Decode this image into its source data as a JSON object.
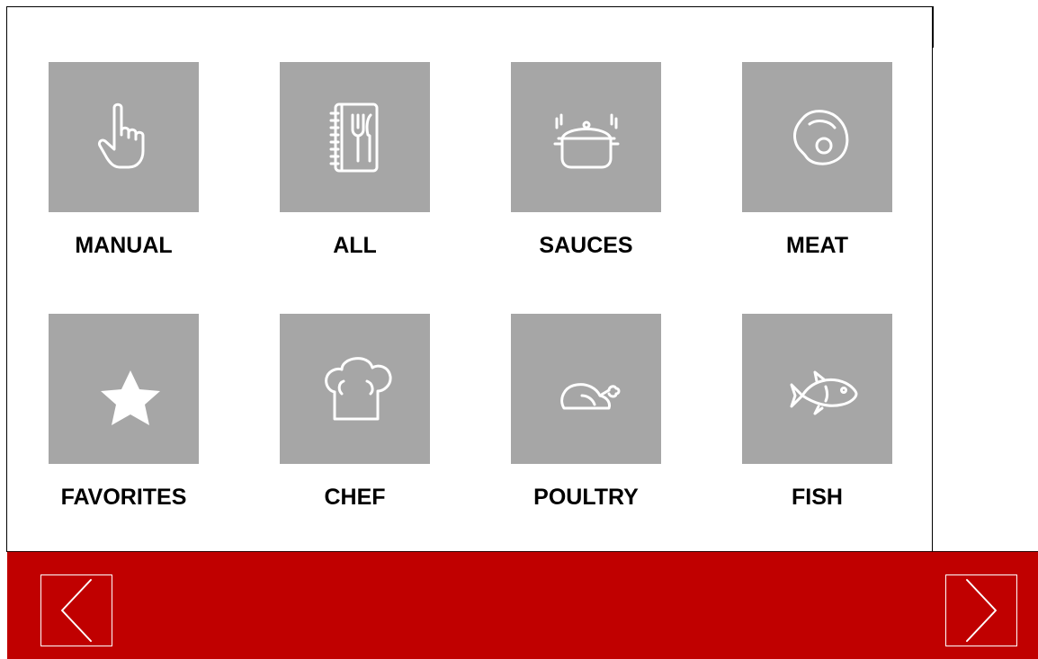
{
  "tiles": [
    {
      "label": "MANUAL",
      "icon": "hand-pointer-icon"
    },
    {
      "label": "ALL",
      "icon": "recipe-book-icon"
    },
    {
      "label": "SAUCES",
      "icon": "cooking-pot-icon"
    },
    {
      "label": "MEAT",
      "icon": "steak-icon"
    },
    {
      "label": "FAVORITES",
      "icon": "star-icon"
    },
    {
      "label": "CHEF",
      "icon": "chef-hat-icon"
    },
    {
      "label": "POULTRY",
      "icon": "roast-chicken-icon"
    },
    {
      "label": "FISH",
      "icon": "fish-icon"
    }
  ],
  "navigation": {
    "previous_icon": "chevron-left-icon",
    "next_icon": "chevron-right-icon"
  },
  "colors": {
    "tile_background": "#a6a6a6",
    "icon_stroke": "#ffffff",
    "bottom_bar": "#c00000",
    "label_text": "#000000"
  }
}
